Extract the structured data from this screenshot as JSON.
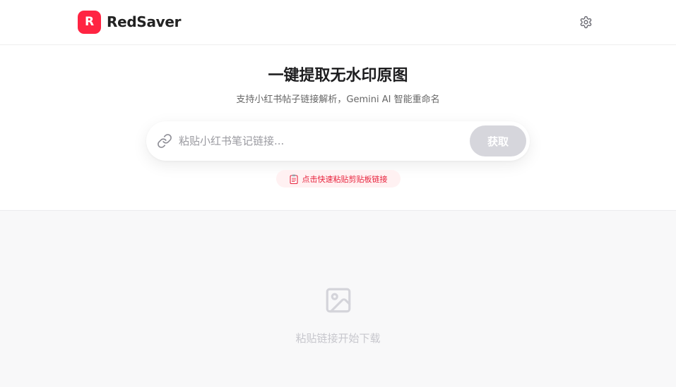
{
  "header": {
    "logo_letter": "R",
    "app_name": "RedSaver",
    "settings_icon": "gear-icon"
  },
  "hero": {
    "title": "一键提取无水印原图",
    "subtitle": "支持小红书帖子链接解析，Gemini AI 智能重命名"
  },
  "search": {
    "placeholder": "粘贴小红书笔记链接...",
    "value": "",
    "link_icon": "link-icon",
    "submit_label": "获取"
  },
  "paste_chip": {
    "icon": "clipboard-icon",
    "label": "点击快速粘贴剪贴板链接"
  },
  "empty_state": {
    "icon": "image-icon",
    "message": "粘贴链接开始下载"
  },
  "colors": {
    "brand": "#ff2442",
    "chip_bg": "#fff1f2",
    "chip_text": "#e8233d",
    "button_disabled": "#d6d6dc",
    "page_bg": "#f8f8f9"
  }
}
